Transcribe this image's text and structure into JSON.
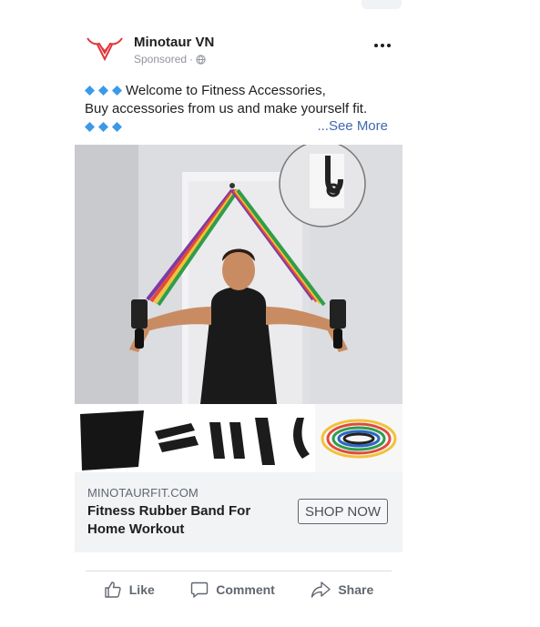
{
  "post": {
    "author": "Minotaur VN",
    "sponsored": "Sponsored",
    "separator": "·",
    "text_line1": "Welcome to Fitness Accessories,",
    "text_line2": "Buy accessories from us and make yourself fit.",
    "see_more": "...See More"
  },
  "cta": {
    "domain": "MINOTAURFIT.COM",
    "title": "Fitness Rubber Band For Home Workout",
    "button": "SHOP NOW"
  },
  "actions": {
    "like": "Like",
    "comment": "Comment",
    "share": "Share"
  },
  "colors": {
    "brand_logo": "#e0363a",
    "link": "#4267b2",
    "diamond": "#3b9ae8"
  },
  "icons": [
    "minotaur-logo",
    "globe-icon",
    "more-icon",
    "diamond-icon",
    "like-icon",
    "comment-icon",
    "share-icon"
  ]
}
